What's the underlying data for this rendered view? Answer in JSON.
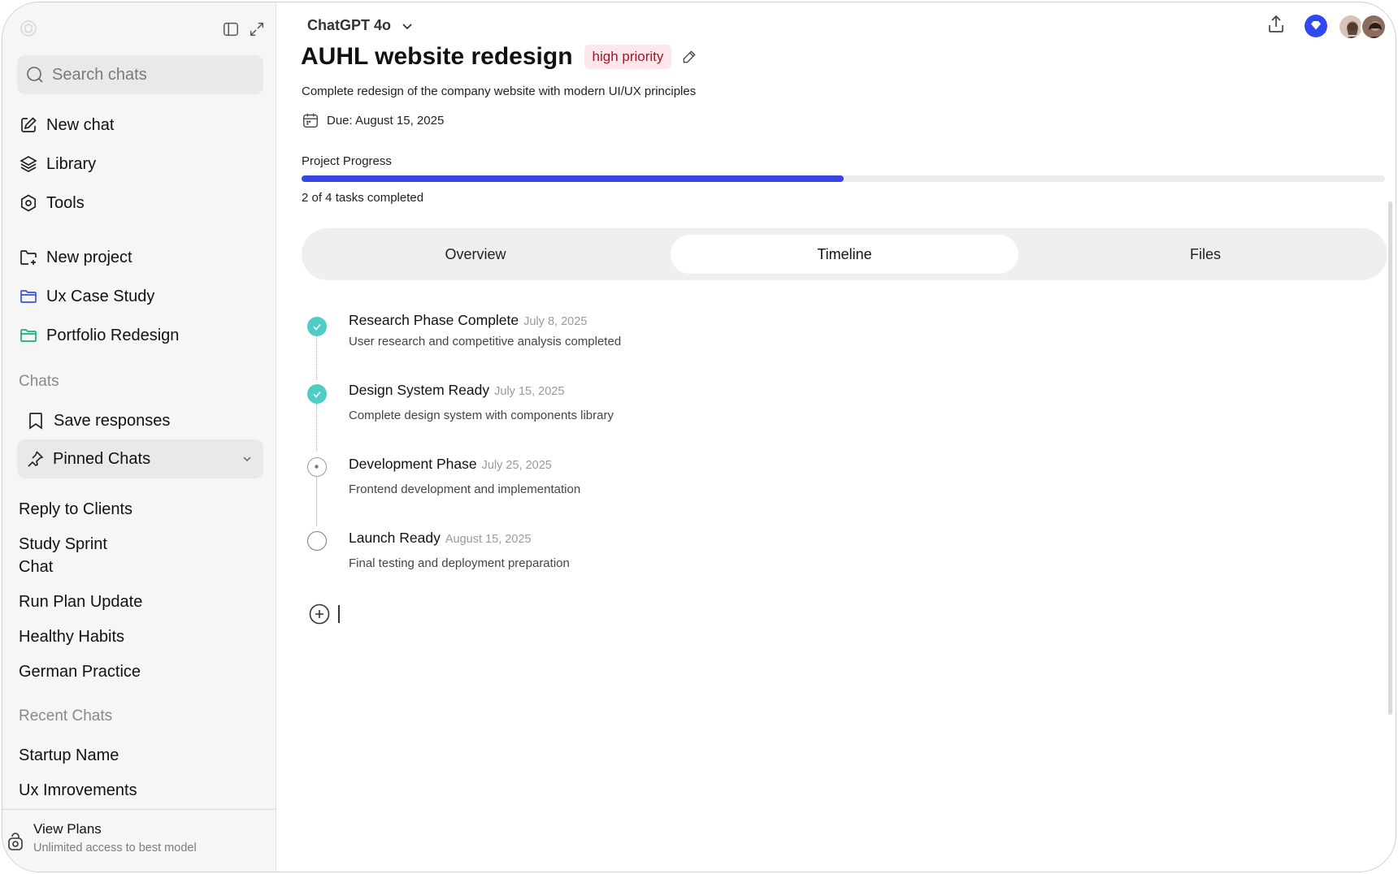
{
  "sidebar": {
    "search_placeholder": "Search chats",
    "nav": [
      {
        "label": "New chat",
        "icon": "edit-icon"
      },
      {
        "label": "Library",
        "icon": "layers-icon"
      },
      {
        "label": "Tools",
        "icon": "tools-icon"
      }
    ],
    "projects": [
      {
        "label": "New project",
        "icon": "new-project-icon"
      },
      {
        "label": "Ux Case Study",
        "icon": "folder-icon",
        "color": "#3b4fe0"
      },
      {
        "label": "Portfolio Redesign",
        "icon": "folder-icon",
        "color": "#18b07a"
      }
    ],
    "chats_title": "Chats",
    "save_responses": "Save responses",
    "pinned_chats": "Pinned Chats",
    "chat_items": [
      "Reply to Clients",
      "Study Sprint Chat",
      "Run Plan Update",
      "Healthy Habits",
      "German Practice"
    ],
    "recent_title": "Recent Chats",
    "recent_items": [
      "Startup Name",
      "Ux Imrovements"
    ],
    "plans": {
      "title": "View Plans",
      "subtitle": "Unlimited access to best model"
    }
  },
  "header": {
    "model": "ChatGPT 4o"
  },
  "project": {
    "title": "AUHL website redesign",
    "priority": "high priority",
    "description": "Complete redesign of the company website with modern UI/UX principles",
    "due": "Due: August 15, 2025",
    "progress_label": "Project Progress",
    "progress_text": "2 of 4 tasks completed",
    "progress_fraction": 0.5
  },
  "tabs": [
    "Overview",
    "Timeline",
    "Files"
  ],
  "active_tab": "Timeline",
  "timeline": [
    {
      "title": "Research Phase Complete",
      "date": "July 8, 2025",
      "desc": "User research and competitive analysis completed",
      "status": "done"
    },
    {
      "title": "Design System Ready",
      "date": "July 15, 2025",
      "desc": "Complete design system with components library",
      "status": "done"
    },
    {
      "title": "Development Phase",
      "date": "July 25, 2025",
      "desc": "Frontend development and implementation",
      "status": "in-progress"
    },
    {
      "title": "Launch Ready",
      "date": "August 15, 2025",
      "desc": "Final testing and deployment preparation",
      "status": "pending"
    }
  ],
  "colors": {
    "accent": "#3846e6",
    "done": "#4ecdc4",
    "badge_bg": "#fde7ea",
    "badge_text": "#a3162a"
  }
}
